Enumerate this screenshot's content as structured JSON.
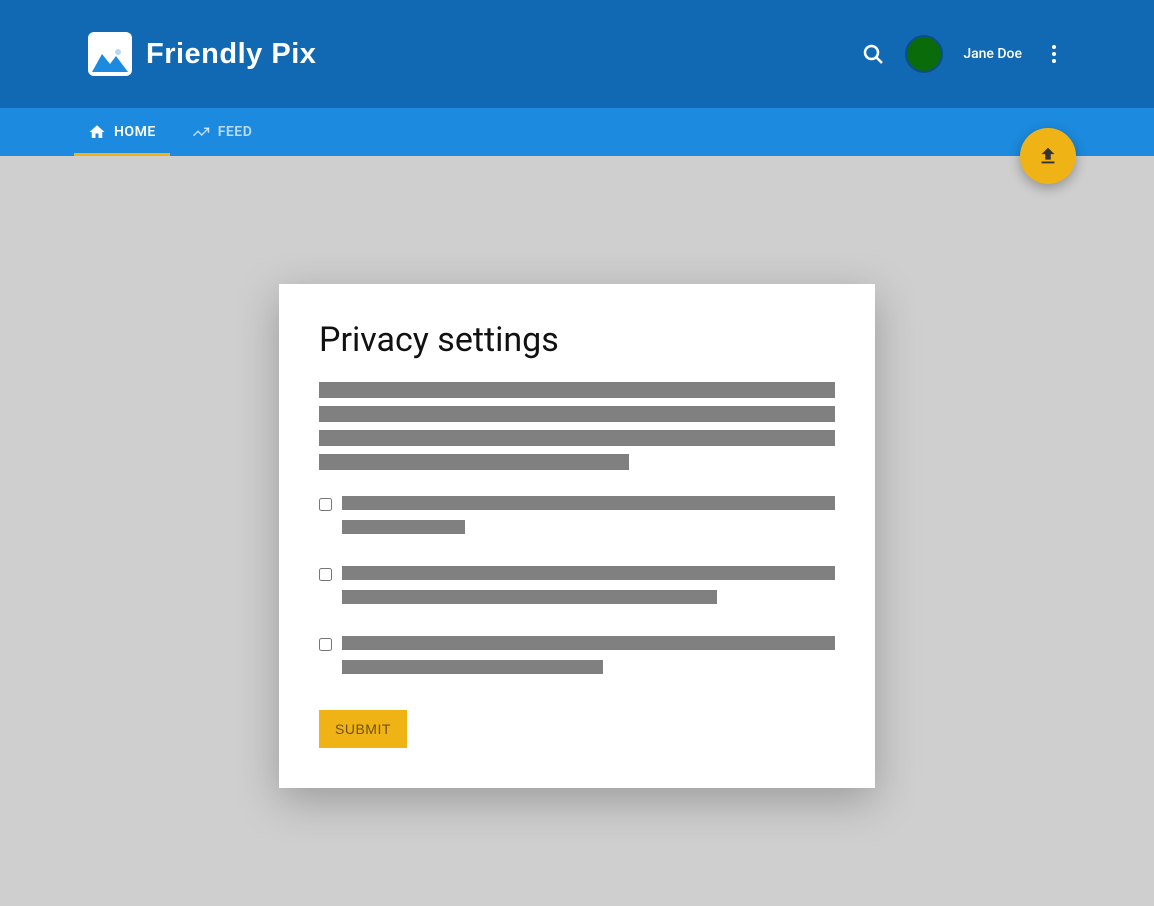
{
  "header": {
    "app_title": "Friendly Pix",
    "username": "Jane Doe"
  },
  "nav": {
    "tabs": [
      {
        "label": "HOME",
        "active": true
      },
      {
        "label": "FEED",
        "active": false
      }
    ]
  },
  "card": {
    "title": "Privacy settings",
    "submit_label": "SUBMIT",
    "checkboxes": [
      {
        "checked": false
      },
      {
        "checked": false
      },
      {
        "checked": false
      }
    ]
  },
  "colors": {
    "header_bg": "#1169b4",
    "nav_bg": "#1c8ade",
    "accent": "#f0b316",
    "page_bg": "#cfcfcf"
  }
}
